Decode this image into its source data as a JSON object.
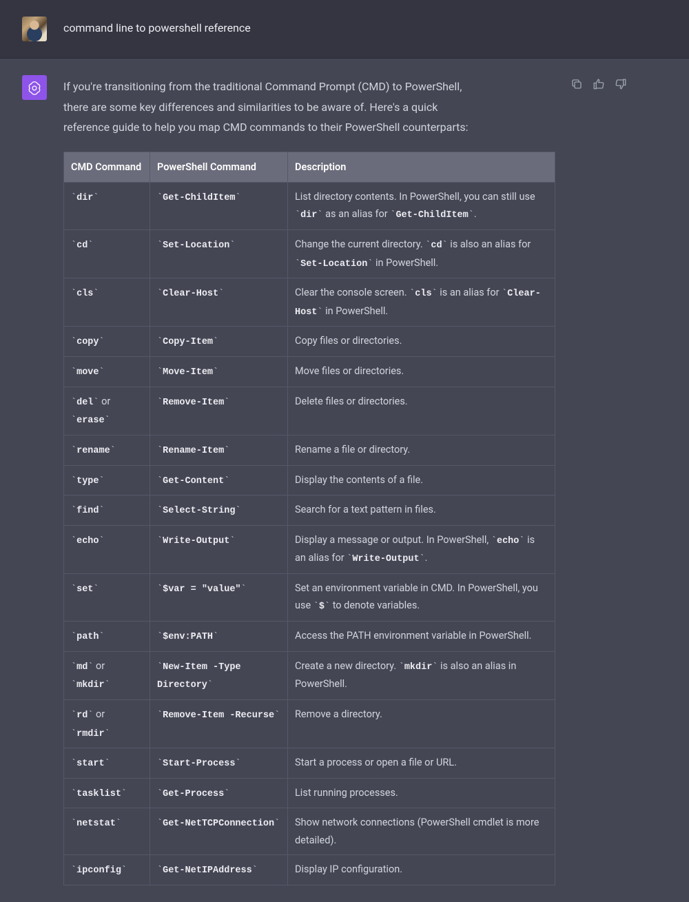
{
  "user_message": "command line to powershell reference",
  "assistant_intro": "If you're transitioning from the traditional Command Prompt (CMD) to PowerShell, there are some key differences and similarities to be aware of. Here's a quick reference guide to help you map CMD commands to their PowerShell counterparts:",
  "table": {
    "headers": [
      "CMD Command",
      "PowerShell Command",
      "Description"
    ],
    "rows": [
      {
        "cmd": [
          {
            "t": "code",
            "v": "dir"
          }
        ],
        "ps": [
          {
            "t": "code",
            "v": "Get-ChildItem"
          }
        ],
        "desc": [
          {
            "t": "text",
            "v": "List directory contents. In PowerShell, you can still use "
          },
          {
            "t": "code",
            "v": "dir"
          },
          {
            "t": "text",
            "v": " as an alias for "
          },
          {
            "t": "code",
            "v": "Get-ChildItem"
          },
          {
            "t": "text",
            "v": "."
          }
        ]
      },
      {
        "cmd": [
          {
            "t": "code",
            "v": "cd"
          }
        ],
        "ps": [
          {
            "t": "code",
            "v": "Set-Location"
          }
        ],
        "desc": [
          {
            "t": "text",
            "v": "Change the current directory. "
          },
          {
            "t": "code",
            "v": "cd"
          },
          {
            "t": "text",
            "v": " is also an alias for "
          },
          {
            "t": "code",
            "v": "Set-Location"
          },
          {
            "t": "text",
            "v": " in PowerShell."
          }
        ]
      },
      {
        "cmd": [
          {
            "t": "code",
            "v": "cls"
          }
        ],
        "ps": [
          {
            "t": "code",
            "v": "Clear-Host"
          }
        ],
        "desc": [
          {
            "t": "text",
            "v": "Clear the console screen. "
          },
          {
            "t": "code",
            "v": "cls"
          },
          {
            "t": "text",
            "v": " is an alias for "
          },
          {
            "t": "code",
            "v": "Clear-Host"
          },
          {
            "t": "text",
            "v": " in PowerShell."
          }
        ]
      },
      {
        "cmd": [
          {
            "t": "code",
            "v": "copy"
          }
        ],
        "ps": [
          {
            "t": "code",
            "v": "Copy-Item"
          }
        ],
        "desc": [
          {
            "t": "text",
            "v": "Copy files or directories."
          }
        ]
      },
      {
        "cmd": [
          {
            "t": "code",
            "v": "move"
          }
        ],
        "ps": [
          {
            "t": "code",
            "v": "Move-Item"
          }
        ],
        "desc": [
          {
            "t": "text",
            "v": "Move files or directories."
          }
        ]
      },
      {
        "cmd": [
          {
            "t": "code",
            "v": "del"
          },
          {
            "t": "text",
            "v": " or "
          },
          {
            "t": "code",
            "v": "erase"
          }
        ],
        "ps": [
          {
            "t": "code",
            "v": "Remove-Item"
          }
        ],
        "desc": [
          {
            "t": "text",
            "v": "Delete files or directories."
          }
        ]
      },
      {
        "cmd": [
          {
            "t": "code",
            "v": "rename"
          }
        ],
        "ps": [
          {
            "t": "code",
            "v": "Rename-Item"
          }
        ],
        "desc": [
          {
            "t": "text",
            "v": "Rename a file or directory."
          }
        ]
      },
      {
        "cmd": [
          {
            "t": "code",
            "v": "type"
          }
        ],
        "ps": [
          {
            "t": "code",
            "v": "Get-Content"
          }
        ],
        "desc": [
          {
            "t": "text",
            "v": "Display the contents of a file."
          }
        ]
      },
      {
        "cmd": [
          {
            "t": "code",
            "v": "find"
          }
        ],
        "ps": [
          {
            "t": "code",
            "v": "Select-String"
          }
        ],
        "desc": [
          {
            "t": "text",
            "v": "Search for a text pattern in files."
          }
        ]
      },
      {
        "cmd": [
          {
            "t": "code",
            "v": "echo"
          }
        ],
        "ps": [
          {
            "t": "code",
            "v": "Write-Output"
          }
        ],
        "desc": [
          {
            "t": "text",
            "v": "Display a message or output. In PowerShell, "
          },
          {
            "t": "code",
            "v": "echo"
          },
          {
            "t": "text",
            "v": " is an alias for "
          },
          {
            "t": "code",
            "v": "Write-Output"
          },
          {
            "t": "text",
            "v": "."
          }
        ]
      },
      {
        "cmd": [
          {
            "t": "code",
            "v": "set"
          }
        ],
        "ps": [
          {
            "t": "code",
            "v": "$var = \"value\""
          }
        ],
        "desc": [
          {
            "t": "text",
            "v": "Set an environment variable in CMD. In PowerShell, you use "
          },
          {
            "t": "code",
            "v": "$"
          },
          {
            "t": "text",
            "v": " to denote variables."
          }
        ]
      },
      {
        "cmd": [
          {
            "t": "code",
            "v": "path"
          }
        ],
        "ps": [
          {
            "t": "code",
            "v": "$env:PATH"
          }
        ],
        "desc": [
          {
            "t": "text",
            "v": "Access the PATH environment variable in PowerShell."
          }
        ]
      },
      {
        "cmd": [
          {
            "t": "code",
            "v": "md"
          },
          {
            "t": "text",
            "v": " or "
          },
          {
            "t": "code",
            "v": "mkdir"
          }
        ],
        "ps": [
          {
            "t": "code",
            "v": "New-Item -Type Directory"
          }
        ],
        "desc": [
          {
            "t": "text",
            "v": "Create a new directory. "
          },
          {
            "t": "code",
            "v": "mkdir"
          },
          {
            "t": "text",
            "v": " is also an alias in PowerShell."
          }
        ]
      },
      {
        "cmd": [
          {
            "t": "code",
            "v": "rd"
          },
          {
            "t": "text",
            "v": " or "
          },
          {
            "t": "code",
            "v": "rmdir"
          }
        ],
        "ps": [
          {
            "t": "code",
            "v": "Remove-Item -Recurse"
          }
        ],
        "desc": [
          {
            "t": "text",
            "v": "Remove a directory."
          }
        ]
      },
      {
        "cmd": [
          {
            "t": "code",
            "v": "start"
          }
        ],
        "ps": [
          {
            "t": "code",
            "v": "Start-Process"
          }
        ],
        "desc": [
          {
            "t": "text",
            "v": "Start a process or open a file or URL."
          }
        ]
      },
      {
        "cmd": [
          {
            "t": "code",
            "v": "tasklist"
          }
        ],
        "ps": [
          {
            "t": "code",
            "v": "Get-Process"
          }
        ],
        "desc": [
          {
            "t": "text",
            "v": "List running processes."
          }
        ]
      },
      {
        "cmd": [
          {
            "t": "code",
            "v": "netstat"
          }
        ],
        "ps": [
          {
            "t": "code",
            "v": "Get-NetTCPConnection"
          }
        ],
        "desc": [
          {
            "t": "text",
            "v": "Show network connections (PowerShell cmdlet is more detailed)."
          }
        ]
      },
      {
        "cmd": [
          {
            "t": "code",
            "v": "ipconfig"
          }
        ],
        "ps": [
          {
            "t": "code",
            "v": "Get-NetIPAddress"
          }
        ],
        "desc": [
          {
            "t": "text",
            "v": "Display IP configuration."
          }
        ]
      }
    ]
  }
}
